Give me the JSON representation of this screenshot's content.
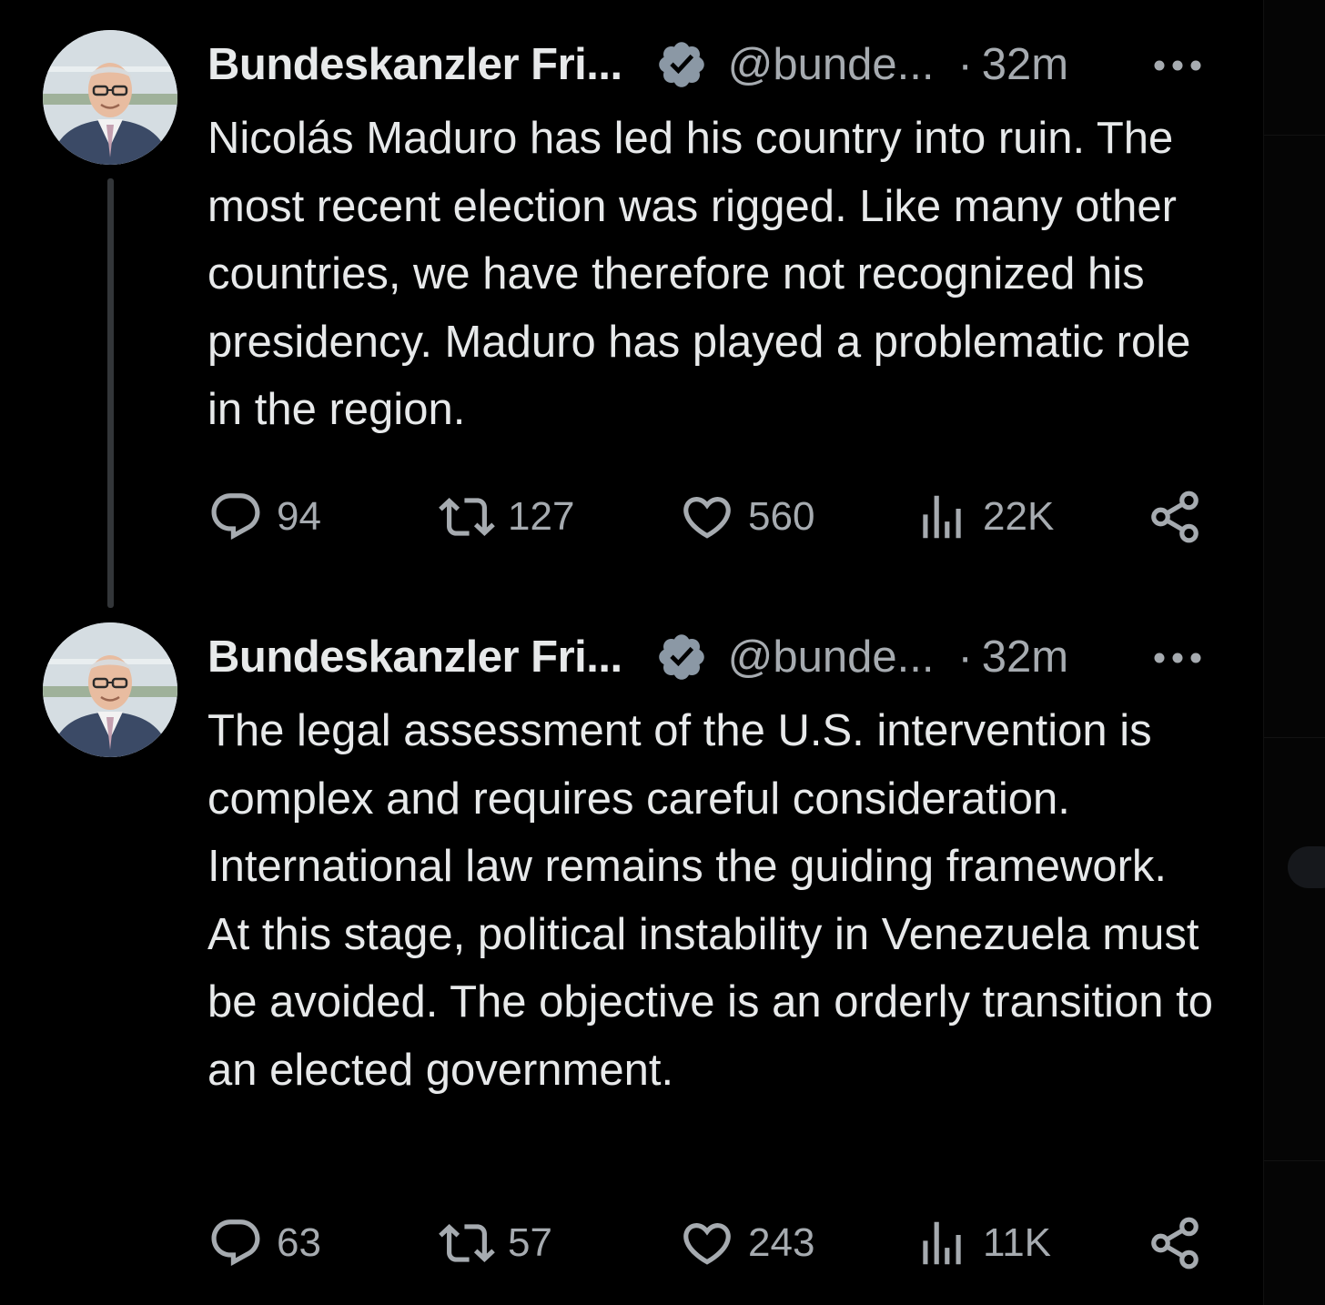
{
  "tweets": [
    {
      "author_name": "Bundeskanzler Fri...",
      "handle": "@bunde...",
      "separator": "·",
      "time": "32m",
      "text": "Nicolás Maduro has led his country into ruin. The most recent election was rigged. Like many other countries, we have therefore not recognized his presidency. Maduro has played a problematic role in the region.",
      "replies": "94",
      "reposts": "127",
      "likes": "560",
      "views": "22K"
    },
    {
      "author_name": "Bundeskanzler Fri...",
      "handle": "@bunde...",
      "separator": "·",
      "time": "32m",
      "text": "The legal assessment of the U.S. intervention is complex and requires careful consideration. International law remains the guiding framework. At this stage, political instability in Venezuela must be avoided. The objective is an orderly transition to an elected government.",
      "replies": "63",
      "reposts": "57",
      "likes": "243",
      "views": "11K"
    }
  ],
  "icons": {
    "verified": "verified-badge-icon",
    "more": "more-icon",
    "reply": "reply-icon",
    "repost": "repost-icon",
    "like": "heart-icon",
    "views": "views-icon",
    "share": "share-icon"
  },
  "colors": {
    "background": "#000000",
    "text": "#e7e9ea",
    "muted": "#a6abb0",
    "verified_badge": "#8b98a5",
    "thread_line": "#333639"
  }
}
